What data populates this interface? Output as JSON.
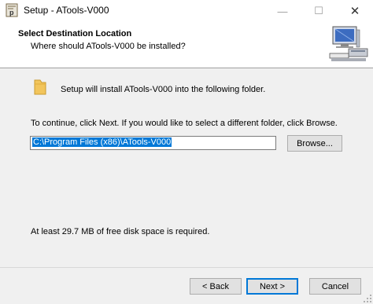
{
  "window": {
    "title": "Setup - ATools-V000",
    "minimize_glyph": "—",
    "maximize_glyph": "☐",
    "close_glyph": "✕"
  },
  "header": {
    "title": "Select Destination Location",
    "subtitle": "Where should ATools-V000 be installed?"
  },
  "body": {
    "intro": "Setup will install ATools-V000 into the following folder.",
    "instruction": "To continue, click Next. If you would like to select a different folder, click Browse.",
    "path_value": "C:\\Program Files (x86)\\ATools-V000",
    "browse_label": "Browse...",
    "disk_space": "At least 29.7 MB of free disk space is required."
  },
  "footer": {
    "back_label": "< Back",
    "next_label": "Next >",
    "cancel_label": "Cancel"
  },
  "icons": {
    "app": "setup-app-icon",
    "wizard": "computer-install-icon",
    "folder": "folder-icon"
  },
  "colors": {
    "accent": "#0078d7",
    "window_bg": "#f0f0f0",
    "header_bg": "#ffffff",
    "folder": "#f2c55c"
  }
}
